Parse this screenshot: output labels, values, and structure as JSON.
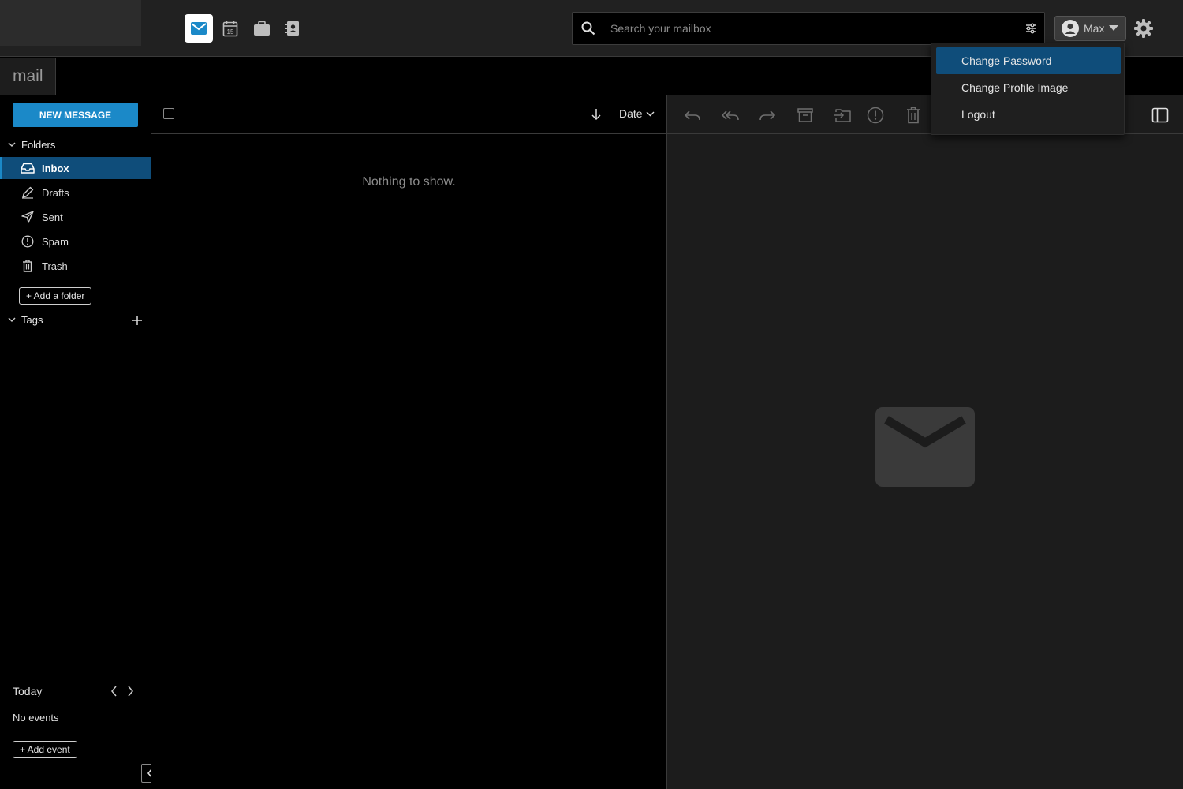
{
  "apps": [
    {
      "name": "mail-icon",
      "active": true
    },
    {
      "name": "calendar-icon",
      "active": false
    },
    {
      "name": "briefcase-icon",
      "active": false
    },
    {
      "name": "contacts-icon",
      "active": false
    }
  ],
  "calendar_icon_day": "15",
  "search": {
    "placeholder": "Search your mailbox"
  },
  "user": {
    "name": "Max"
  },
  "module": {
    "title": "mail"
  },
  "sidebar": {
    "new_message": "NEW MESSAGE",
    "folders_label": "Folders",
    "folders": [
      {
        "label": "Inbox",
        "icon": "inbox-icon",
        "active": true
      },
      {
        "label": "Drafts",
        "icon": "pencil-icon",
        "active": false
      },
      {
        "label": "Sent",
        "icon": "send-icon",
        "active": false
      },
      {
        "label": "Spam",
        "icon": "alert-circle-icon",
        "active": false
      },
      {
        "label": "Trash",
        "icon": "trash-icon",
        "active": false
      }
    ],
    "add_folder": "+ Add a folder",
    "tags_label": "Tags"
  },
  "calendar": {
    "today": "Today",
    "no_events": "No events",
    "add_event": "+ Add event"
  },
  "list": {
    "sort_label": "Date",
    "empty": "Nothing to show."
  },
  "user_menu": [
    {
      "label": "Change Password",
      "active": true
    },
    {
      "label": "Change Profile Image",
      "active": false
    },
    {
      "label": "Logout",
      "active": false
    }
  ],
  "colors": {
    "accent": "#1b89c8",
    "selected": "#0f4d7a",
    "background": "#000000",
    "panel": "#1c1c1c"
  }
}
